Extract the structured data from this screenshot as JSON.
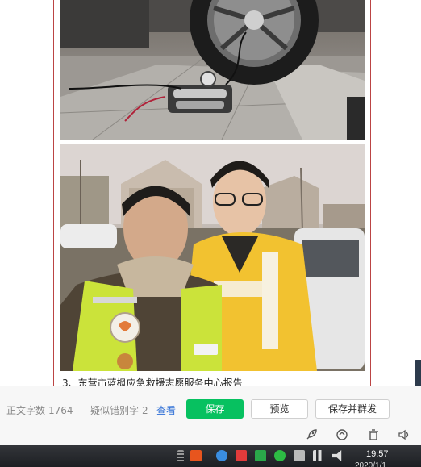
{
  "article": {
    "caption": "3、东营市蓝枫应急救援志愿服务中心报告"
  },
  "toolbar": {
    "word_count_label": "正文字数",
    "word_count_value": "1764",
    "typo_label": "疑似错别字",
    "typo_value": "2",
    "view_link": "查看",
    "save_label": "保存",
    "preview_label": "预览",
    "save_send_label": "保存并群发"
  },
  "taskbar": {
    "clock": "19:57",
    "date": "2020/1/1"
  },
  "colors": {
    "primary": "#07c160",
    "link": "#2f6fd6",
    "frame_border": "#b44444"
  }
}
